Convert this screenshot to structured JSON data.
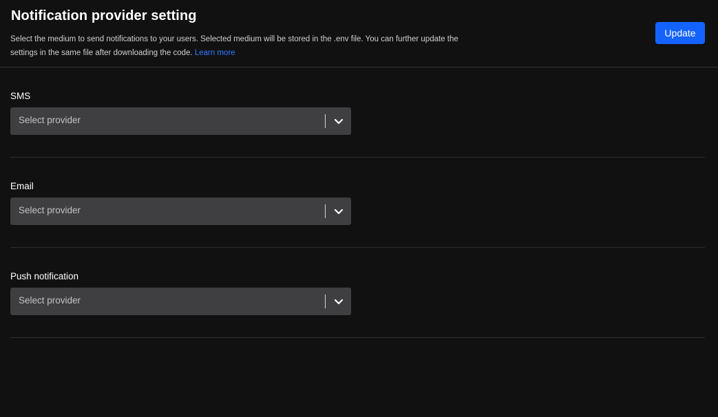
{
  "header": {
    "title": "Notification provider setting",
    "description": "Select the medium to send notifications to your users. Selected medium will be stored in the .env file. You can further update the settings in the same file after downloading the code.",
    "learn_more": "Learn more",
    "update_label": "Update"
  },
  "sections": [
    {
      "label": "SMS",
      "placeholder": "Select provider",
      "icon": "chevron-down-icon"
    },
    {
      "label": "Email",
      "placeholder": "Select provider",
      "icon": "chevron-down-icon"
    },
    {
      "label": "Push notification",
      "placeholder": "Select provider",
      "icon": "chevron-down-icon"
    }
  ],
  "colors": {
    "background": "#111112",
    "accent": "#1463ff",
    "link": "#2f7bff",
    "select_background": "#3f3f41"
  }
}
